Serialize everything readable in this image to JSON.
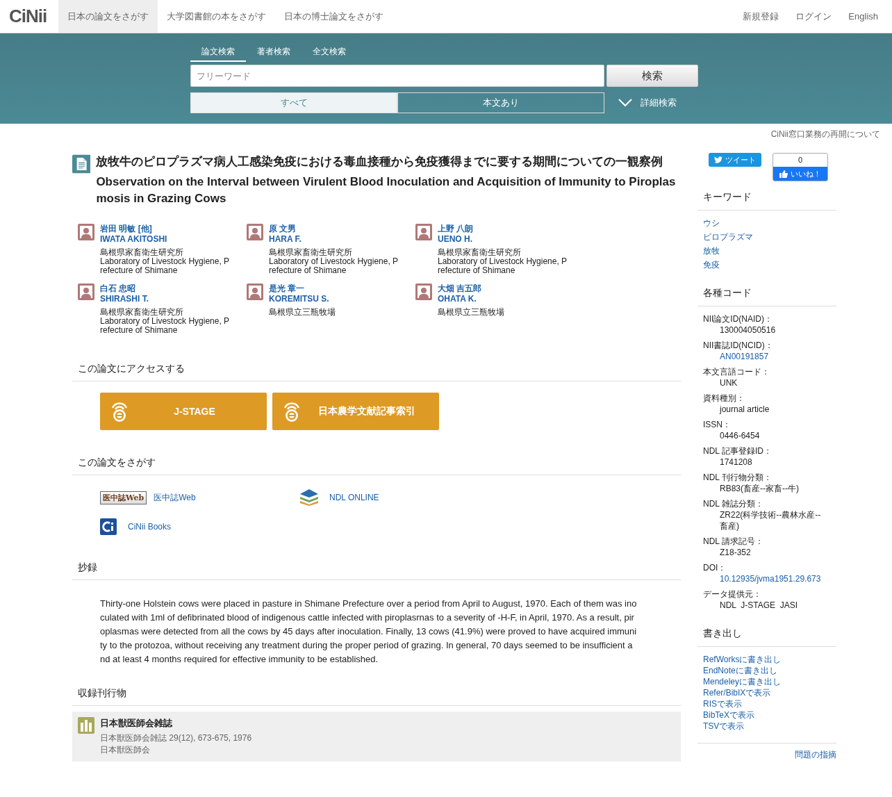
{
  "header": {
    "logo": "CiNii",
    "nav": [
      {
        "label": "日本の論文をさがす",
        "selected": true
      },
      {
        "label": "大学図書館の本をさがす",
        "selected": false
      },
      {
        "label": "日本の博士論文をさがす",
        "selected": false
      }
    ],
    "links": [
      "新規登録",
      "ログイン",
      "English"
    ]
  },
  "search": {
    "tabs": [
      {
        "label": "論文検索",
        "selected": true
      },
      {
        "label": "著者検索",
        "selected": false
      },
      {
        "label": "全文検索",
        "selected": false
      }
    ],
    "placeholder": "フリーワード",
    "button": "検索",
    "scopes": [
      {
        "label": "すべて",
        "selected": true
      },
      {
        "label": "本文あり",
        "selected": false
      }
    ],
    "advanced": "詳細検索"
  },
  "notice": "CiNii窓口業務の再開について",
  "article": {
    "title_ja": "放牧牛のピロプラズマ病人工感染免疫における毒血接種から免疫獲得までに要する期間についての一観察例",
    "title_en": "Observation on the Interval between Virulent Blood Inoculation and Acquisition of Immunity to Piroplasmosis in Grazing Cows",
    "authors": [
      {
        "name_ja": "岩田 明敏 [他]",
        "name_en": "IWATA AKITOSHI",
        "affiliations": [
          "島根県家畜衛生研究所",
          "Laboratory of Livestock Hygiene, Prefecture of Shimane"
        ]
      },
      {
        "name_ja": "原 文男",
        "name_en": "HARA F.",
        "affiliations": [
          "島根県家畜衛生研究所",
          "Laboratory of Livestock Hygiene, Prefecture of Shimane"
        ]
      },
      {
        "name_ja": "上野 八朗",
        "name_en": "UENO H.",
        "affiliations": [
          "島根県家畜衛生研究所",
          "Laboratory of Livestock Hygiene, Prefecture of Shimane"
        ]
      },
      {
        "name_ja": "白石 忠昭",
        "name_en": "SHIRASHI T.",
        "affiliations": [
          "島根県家畜衛生研究所",
          "Laboratory of Livestock Hygiene, Prefecture of Shimane"
        ]
      },
      {
        "name_ja": "是光 章一",
        "name_en": "KOREMITSU S.",
        "affiliations": [
          "島根県立三瓶牧場"
        ]
      },
      {
        "name_ja": "大畑 吉五郎",
        "name_en": "OHATA K.",
        "affiliations": [
          "島根県立三瓶牧場"
        ]
      }
    ],
    "access": {
      "heading": "この論文にアクセスする",
      "buttons": [
        "J-STAGE",
        "日本農学文献記事索引"
      ]
    },
    "find": {
      "heading": "この論文をさがす",
      "links": [
        {
          "kind": "ichushi",
          "logo_text": "医中誌Web",
          "label": "医中誌Web"
        },
        {
          "kind": "ndl",
          "label": "NDL ONLINE"
        },
        {
          "kind": "cinii",
          "label": "CiNii Books"
        }
      ]
    },
    "abstract": {
      "heading": "抄録",
      "text": "Thirty-one Holstein cows were placed in pasture in Shimane Prefecture over a period from April to August, 1970. Each of them was inoculated with 1ml of defibrinated blood of indigenous cattle infected with piroplasrnas to a severity of -H-F, in April, 1970. As a result, piroplasmas were detected from all the cows by 45 days after inoculation. Finally, 13 cows (41.9%) were proved to have acquired immunity to the protozoa, without receiving any treatment during the proper period of grazing. In general, 70 days seemed to be insufficient and at least 4 months required for effective immunity to be established."
    },
    "journal": {
      "heading": "収録刊行物",
      "title": "日本獣医師会雑誌",
      "citation": "日本獣医師会雑誌 29(12), 673-675, 1976",
      "publisher": "日本獣医師会"
    }
  },
  "sidebar": {
    "tweet": "ツイート",
    "like_count": "0",
    "like": "いいね！",
    "keywords": {
      "heading": "キーワード",
      "items": [
        "ウシ",
        "ピロプラズマ",
        "放牧",
        "免疫"
      ]
    },
    "codes": {
      "heading": "各種コード",
      "items": [
        {
          "label": "NII論文ID(NAID)：",
          "value": "130004050516",
          "link": false
        },
        {
          "label": "NII書誌ID(NCID)：",
          "value": "AN00191857",
          "link": true
        },
        {
          "label": "本文言語コード：",
          "value": "UNK",
          "link": false
        },
        {
          "label": "資料種別：",
          "value": "journal article",
          "link": false
        },
        {
          "label": "ISSN：",
          "value": "0446-6454",
          "link": false
        },
        {
          "label": "NDL 記事登録ID：",
          "value": "1741208",
          "link": false
        },
        {
          "label": "NDL 刊行物分類：",
          "value": "RB83(畜産--家畜--牛)",
          "link": false
        },
        {
          "label": "NDL 雑誌分類：",
          "value": "ZR22(科学技術--農林水産--畜産)",
          "link": false
        },
        {
          "label": "NDL 請求記号：",
          "value": "Z18-352",
          "link": false
        },
        {
          "label": "DOI：",
          "value": "10.12935/jvma1951.29.673",
          "link": true
        },
        {
          "label": "データ提供元：",
          "value": "NDL  J-STAGE  JASI",
          "link": false
        }
      ]
    },
    "export": {
      "heading": "書き出し",
      "items": [
        "RefWorksに書き出し",
        "EndNoteに書き出し",
        "Mendeleyに書き出し",
        "Refer/BibIXで表示",
        "RISで表示",
        "BibTeXで表示",
        "TSVで表示"
      ]
    },
    "report": "問題の指摘"
  }
}
